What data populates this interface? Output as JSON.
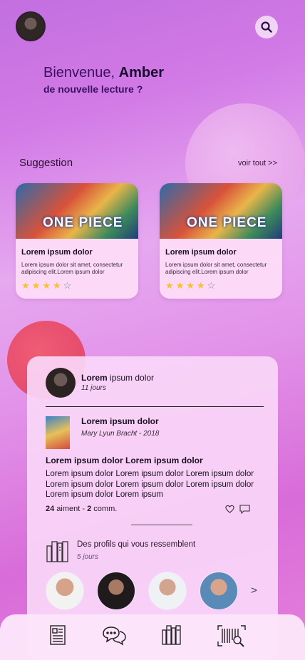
{
  "header": {
    "avatar": "user-avatar",
    "search_icon": "search-icon"
  },
  "welcome": {
    "greeting": "Bienvenue, ",
    "name": "Amber",
    "subtitle": "de nouvelle lecture ?"
  },
  "suggestion": {
    "title": "Suggestion",
    "see_all": "voir tout >>",
    "cards": [
      {
        "cover_text": "ONE PIECE",
        "title": "Lorem ipsum dolor",
        "description": "Lorem ipsum dolor sit amet, consectetur adipiscing elit.Lorem ipsum dolor",
        "rating": 4,
        "max_rating": 5
      },
      {
        "cover_text": "ONE PIECE",
        "title": "Lorem ipsum dolor",
        "description": "Lorem ipsum dolor sit amet, consectetur adipiscing elit.Lorem ipsum dolor",
        "rating": 4,
        "max_rating": 5
      }
    ]
  },
  "post": {
    "author_bold": "Lorem",
    "author_rest": " ipsum dolor",
    "time": "11 jours",
    "book_title": "Lorem ipsum dolor",
    "book_author": "Mary Lyun Bracht - 2018",
    "heading": "Lorem ipsum dolor Lorem ipsum dolor",
    "body": "Lorem ipsum dolor Lorem ipsum dolor Lorem ipsum dolor Lorem ipsum dolor Lorem ipsum dolor Lorem ipsum dolor Lorem ipsum dolor Lorem ipsum",
    "likes": "24",
    "likes_label": " aiment",
    "separator": " - ",
    "comments": "2",
    "comments_label": " comm."
  },
  "profiles": {
    "title": "Des profils qui vous ressemblent",
    "time": "5 jours",
    "next": ">"
  },
  "tabbar": {
    "items": [
      "news-icon",
      "chat-icon",
      "library-icon",
      "barcode-scan-icon"
    ]
  },
  "colors": {
    "accent_text": "#3a1060",
    "star": "#f6c32a",
    "panel": "#fad7f8"
  }
}
